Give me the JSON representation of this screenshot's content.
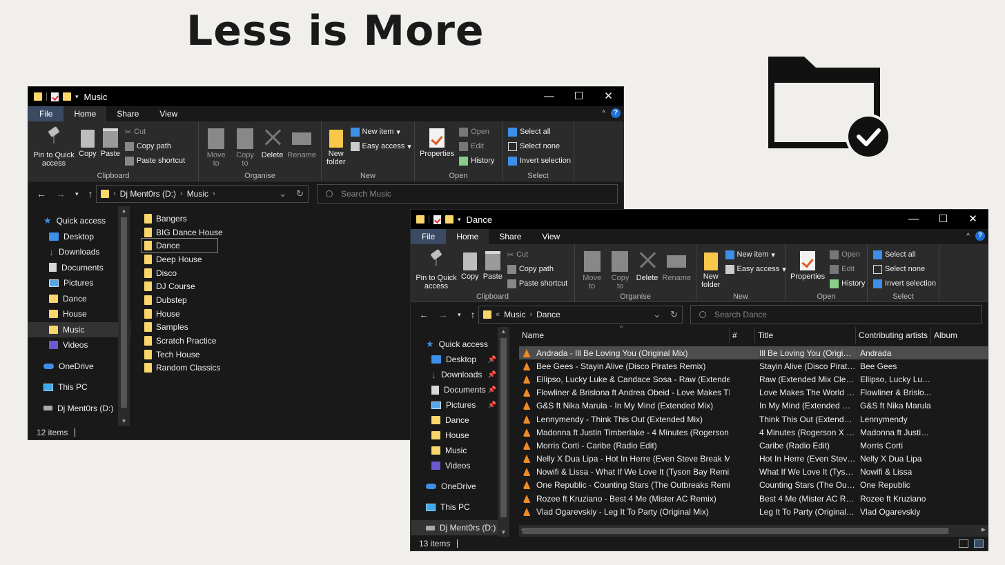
{
  "headline": "Less is More",
  "window_music": {
    "title": "Music",
    "tabs": {
      "file": "File",
      "home": "Home",
      "share": "Share",
      "view": "View"
    },
    "ribbon": {
      "pin_quick_access": "Pin to Quick access",
      "copy": "Copy",
      "paste": "Paste",
      "cut": "Cut",
      "copy_path": "Copy path",
      "paste_shortcut": "Paste shortcut",
      "clipboard": "Clipboard",
      "move_to": "Move to",
      "copy_to": "Copy to",
      "delete": "Delete",
      "rename": "Rename",
      "organise": "Organise",
      "new_folder": "New folder",
      "new_item": "New item",
      "easy_access": "Easy access",
      "new": "New",
      "properties": "Properties",
      "open_btn": "Open",
      "edit": "Edit",
      "history": "History",
      "open_group": "Open",
      "select_all": "Select all",
      "select_none": "Select none",
      "invert_selection": "Invert selection",
      "select_group": "Select"
    },
    "address": {
      "drive": "Dj Ment0rs (D:)",
      "folder": "Music"
    },
    "search_placeholder": "Search Music",
    "nav": {
      "quick_access": "Quick access",
      "desktop": "Desktop",
      "downloads": "Downloads",
      "documents": "Documents",
      "pictures": "Pictures",
      "dance": "Dance",
      "house": "House",
      "music": "Music",
      "videos": "Videos",
      "onedrive": "OneDrive",
      "this_pc": "This PC",
      "drive": "Dj Ment0rs (D:)"
    },
    "folders": [
      "Bangers",
      "BIG Dance House",
      "Dance",
      "Deep House",
      "Disco",
      "DJ Course",
      "Dubstep",
      "House",
      "Samples",
      "Scratch Practice",
      "Tech House",
      "Random Classics"
    ],
    "status": "12 items"
  },
  "window_dance": {
    "title": "Dance",
    "tabs": {
      "file": "File",
      "home": "Home",
      "share": "Share",
      "view": "View"
    },
    "address": {
      "prefix": "«",
      "parent": "Music",
      "folder": "Dance"
    },
    "search_placeholder": "Search Dance",
    "nav": {
      "quick_access": "Quick access",
      "desktop": "Desktop",
      "downloads": "Downloads",
      "documents": "Documents",
      "pictures": "Pictures",
      "dance": "Dance",
      "house": "House",
      "music": "Music",
      "videos": "Videos",
      "onedrive": "OneDrive",
      "this_pc": "This PC",
      "drive": "Dj Ment0rs (D:)"
    },
    "columns": {
      "name": "Name",
      "num": "#",
      "title": "Title",
      "artists": "Contributing artists",
      "album": "Album"
    },
    "tracks": [
      {
        "name": "Andrada - Ill Be Loving You (Original Mix)",
        "title": "Ill Be Loving You (Original...",
        "artist": "Andrada"
      },
      {
        "name": "Bee Gees - Stayin Alive (Disco Pirates Remix)",
        "title": "Stayin Alive (Disco Pirates...",
        "artist": "Bee Gees"
      },
      {
        "name": "Ellipso, Lucky Luke & Candace Sosa - Raw (Extended M...",
        "title": "Raw (Extended Mix Clean)",
        "artist": "Ellipso, Lucky Luk..."
      },
      {
        "name": "Flowliner & Brislona ft Andrea Obeid - Love Makes The ...",
        "title": "Love Makes The World Go...",
        "artist": "Flowliner & Brislo..."
      },
      {
        "name": "G&S ft Nika Marula - In My Mind (Extended Mix)",
        "title": "In My Mind (Extended Mix)",
        "artist": "G&S ft Nika Marula"
      },
      {
        "name": "Lennymendy - Think This Out (Extended Mix)",
        "title": "Think This Out (Extended ...",
        "artist": "Lennymendy"
      },
      {
        "name": "Madonna ft Justin Timberlake - 4 Minutes (Rogerson X ...",
        "title": "4 Minutes (Rogerson X Pi...",
        "artist": "Madonna ft Justin..."
      },
      {
        "name": "Morris Corti - Caribe (Radio Edit)",
        "title": "Caribe (Radio Edit)",
        "artist": "Morris Corti"
      },
      {
        "name": "Nelly X Dua Lipa - Hot In Herre (Even Steve Break My H...",
        "title": "Hot In Herre (Even Steve ...",
        "artist": "Nelly X Dua Lipa"
      },
      {
        "name": "Nowifi & Lissa - What If We Love It (Tyson Bay Remix)",
        "title": "What If We Love It (Tyson ...",
        "artist": "Nowifi & Lissa"
      },
      {
        "name": "One Republic - Counting Stars (The Outbreaks Remix)",
        "title": "Counting Stars (The Outb...",
        "artist": "One Republic"
      },
      {
        "name": "Rozee ft Kruziano - Best 4 Me (Mister AC Remix)",
        "title": "Best 4 Me (Mister AC Rem...",
        "artist": "Rozee ft Kruziano"
      },
      {
        "name": "Vlad Ogarevskiy - Leg It To Party (Original Mix)",
        "title": "Leg It To Party (Original M...",
        "artist": "Vlad Ogarevskiy"
      }
    ],
    "status": "13 items"
  },
  "icons": {
    "big_folder": "folder-check-icon",
    "back": "arrow-left-icon",
    "forward": "arrow-right-icon",
    "up": "arrow-up-icon",
    "refresh": "refresh-icon",
    "search": "search-icon",
    "track": "vlc-icon"
  },
  "colors": {
    "folder": "#f9d66b",
    "accent": "#3d8fe8",
    "file_tab": "#3a4a63",
    "vlc": "#f08a24",
    "background": "#f1efeb"
  }
}
